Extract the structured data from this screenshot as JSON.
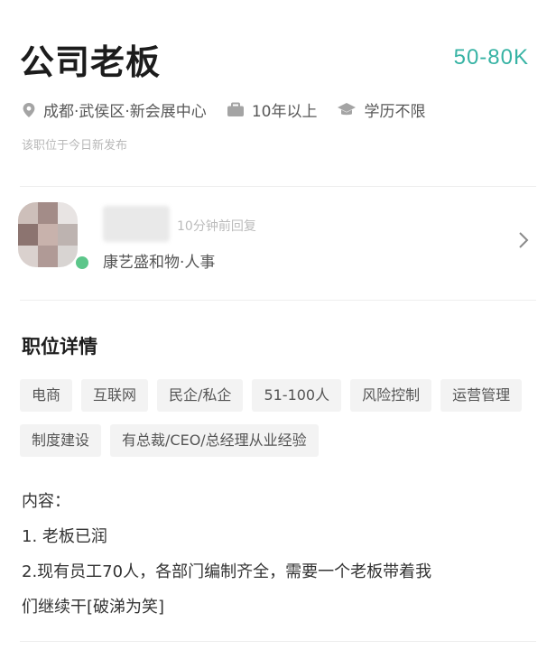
{
  "job": {
    "title": "公司老板",
    "salary": "50-80K",
    "location": "成都·武侯区·新会展中心",
    "experience": "10年以上",
    "education": "学历不限",
    "published": "该职位于今日新发布"
  },
  "recruiter": {
    "reply_time": "10分钟前回复",
    "company_role": "康艺盛和物·人事"
  },
  "details": {
    "section_title": "职位详情",
    "tags": [
      "电商",
      "互联网",
      "民企/私企",
      "51-100人",
      "风险控制",
      "运营管理",
      "制度建设",
      "有总裁/CEO/总经理从业经验"
    ],
    "description": {
      "heading": "内容：",
      "line1": "1. 老板已润",
      "line2": "2.现有员工70人，各部门编制齐全，需要一个老板带着我",
      "line3": "们继续干[破涕为笑]"
    }
  },
  "colors": {
    "salary": "#37b3a4",
    "online": "#5cc68a"
  },
  "icons": {
    "location": "location-pin-icon",
    "experience": "briefcase-icon",
    "education": "graduation-cap-icon",
    "more": "chevron-right-icon"
  }
}
